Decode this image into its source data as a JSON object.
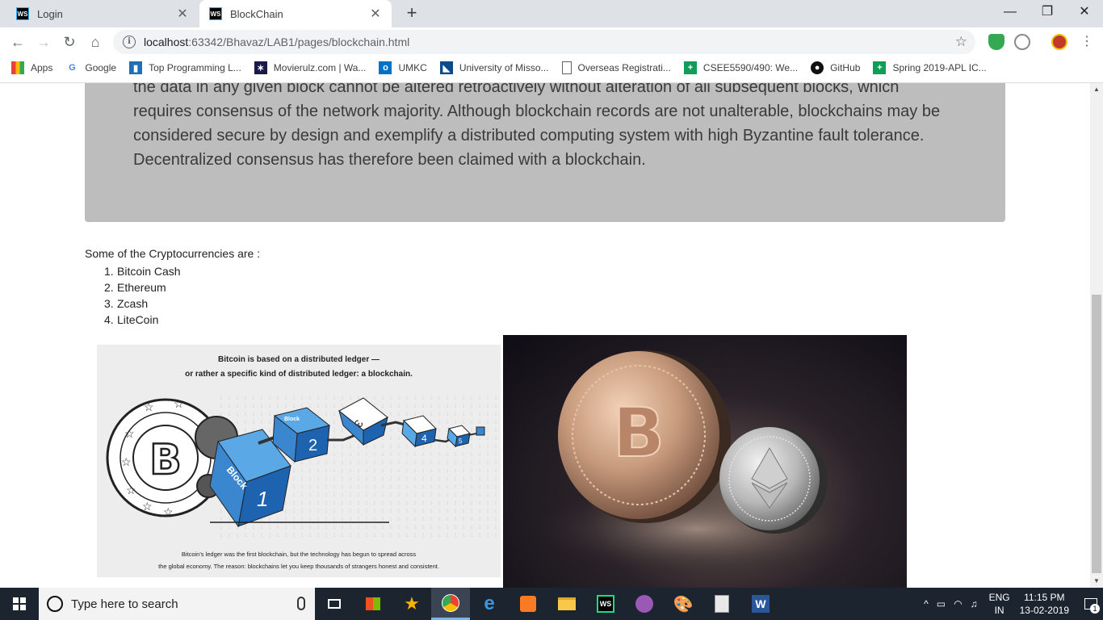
{
  "browser": {
    "tabs": [
      {
        "title": "Login",
        "favicon": "WS"
      },
      {
        "title": "BlockChain",
        "favicon": "WS"
      }
    ],
    "address": {
      "host": "localhost",
      "path": ":63342/Bhavaz/LAB1/pages/blockchain.html"
    },
    "bookmarks": [
      {
        "label": "Apps",
        "icon": "apps-grid-icon"
      },
      {
        "label": "Google",
        "icon": "google-icon"
      },
      {
        "label": "Top Programming L...",
        "icon": "bars-icon"
      },
      {
        "label": "Movierulz.com | Wa...",
        "icon": "movie-icon"
      },
      {
        "label": "UMKC",
        "icon": "outlook-icon"
      },
      {
        "label": "University of Misso...",
        "icon": "umkc-icon"
      },
      {
        "label": "Overseas Registrati...",
        "icon": "page-icon"
      },
      {
        "label": "CSEE5590/490: We...",
        "icon": "plus-green-icon"
      },
      {
        "label": "GitHub",
        "icon": "github-icon"
      },
      {
        "label": "Spring 2019-APL IC...",
        "icon": "plus-green-icon"
      }
    ]
  },
  "page": {
    "paragraph": "the data in any given block cannot be altered retroactively without alteration of all subsequent blocks, which requires consensus of the network majority. Although blockchain records are not unalterable, blockchains may be considered secure by design and exemplify a distributed computing system with high Byzantine fault tolerance. Decentralized consensus has therefore been claimed with a blockchain.",
    "intro": "Some of the Cryptocurrencies are :",
    "coins": [
      "Bitcoin Cash",
      "Ethereum",
      "Zcash",
      "LiteCoin"
    ],
    "image1": {
      "heading_line1": "Bitcoin is based on a distributed ledger —",
      "heading_line2": "or rather a specific kind of distributed ledger: a blockchain.",
      "footer_line1": "Bitcoin's ledger was the first blockchain, but the technology has begun to spread across",
      "footer_line2": "the global economy. The reason: blockchains let you keep thousands of strangers honest and consistent.",
      "block_labels": [
        "1",
        "2",
        "3",
        "4",
        "5"
      ],
      "block_word": "Block"
    }
  },
  "taskbar": {
    "search_placeholder": "Type here to search",
    "lang": "ENG",
    "region": "IN",
    "time": "11:15 PM",
    "date": "13-02-2019",
    "notifications": "1"
  }
}
